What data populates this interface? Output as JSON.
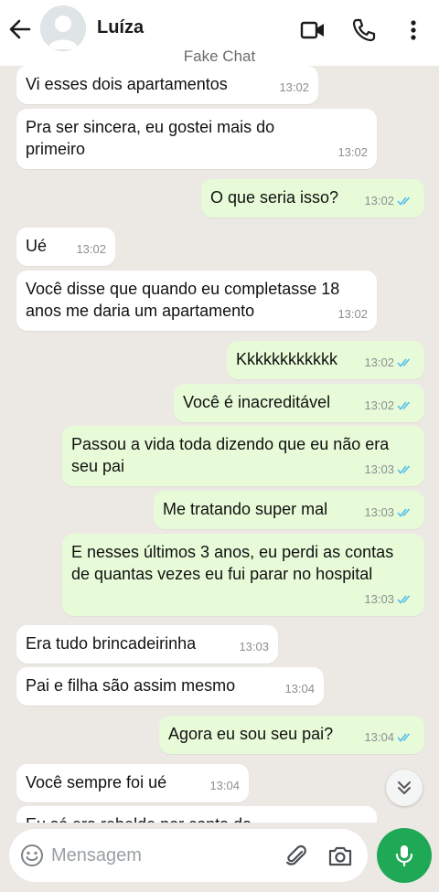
{
  "header": {
    "contact_name": "Luíza",
    "subtitle": "Fake Chat"
  },
  "messages": [
    {
      "dir": "in",
      "text": "Vi esses dois apartamentos",
      "time": "13:02"
    },
    {
      "dir": "in",
      "text": "Pra ser sincera, eu gostei mais do primeiro",
      "time": "13:02"
    },
    {
      "dir": "out",
      "text": "O que seria isso?",
      "time": "13:02",
      "read": true
    },
    {
      "dir": "in",
      "text": "Ué",
      "time": "13:02"
    },
    {
      "dir": "in",
      "text": "Você disse que quando eu completasse 18 anos me daria um apartamento",
      "time": "13:02"
    },
    {
      "dir": "out",
      "text": "Kkkkkkkkkkkk",
      "time": "13:02",
      "read": true
    },
    {
      "dir": "out",
      "text": "Você é inacreditável",
      "time": "13:02",
      "read": true
    },
    {
      "dir": "out",
      "text": "Passou a vida toda dizendo que eu não era seu pai",
      "time": "13:03",
      "read": true
    },
    {
      "dir": "out",
      "text": "Me tratando super mal",
      "time": "13:03",
      "read": true
    },
    {
      "dir": "out",
      "text": "E nesses últimos 3 anos, eu perdi as contas de quantas vezes eu fui parar no hospital",
      "time": "13:03",
      "read": true
    },
    {
      "dir": "in",
      "text": "Era tudo brincadeirinha",
      "time": "13:03"
    },
    {
      "dir": "in",
      "text": "Pai e filha são assim mesmo",
      "time": "13:04"
    },
    {
      "dir": "out",
      "text": "Agora eu sou seu pai?",
      "time": "13:04",
      "read": true
    },
    {
      "dir": "in",
      "text": "Você sempre foi ué",
      "time": "13:04"
    },
    {
      "dir": "in",
      "text": "Eu só era rebelde por conta da",
      "time": ""
    }
  ],
  "composer": {
    "placeholder": "Mensagem"
  },
  "icons": {
    "back": "arrow-left-icon",
    "video": "video-call-icon",
    "call": "phone-icon",
    "menu": "more-vertical-icon",
    "emoji": "emoji-icon",
    "attach": "paperclip-icon",
    "camera": "camera-icon",
    "mic": "microphone-icon",
    "scroll": "double-chevron-down-icon"
  },
  "colors": {
    "incoming_bubble": "#ffffff",
    "outgoing_bubble": "#e7fbd8",
    "read_ticks": "#53bdeb",
    "accent_green": "#1fa855"
  }
}
